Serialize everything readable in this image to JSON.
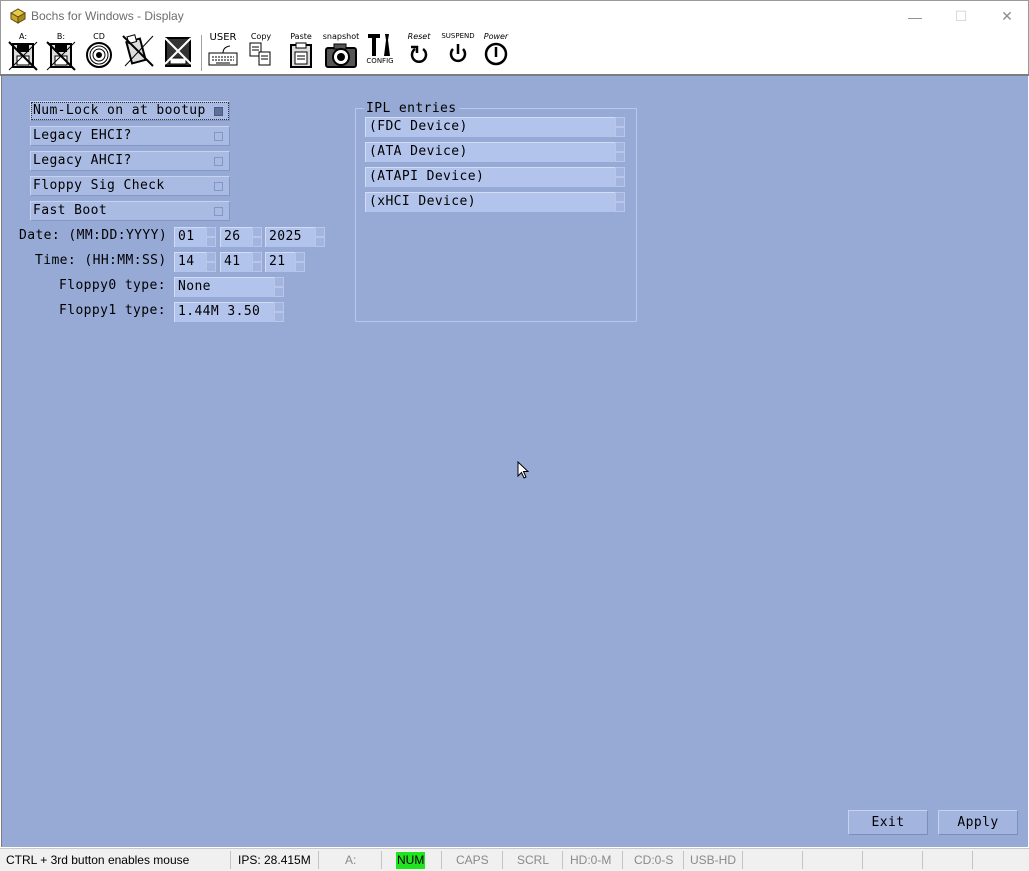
{
  "window": {
    "title": "Bochs for Windows - Display",
    "minimize_glyph": "—",
    "maximize_glyph": "☐",
    "close_glyph": "✕"
  },
  "toolbar": {
    "floppy_a_label": "A:",
    "floppy_b_label": "B:",
    "cdrom_label": "CD",
    "user_label": "USER",
    "copy_label": "Copy",
    "paste_label": "Paste",
    "snapshot_label": "snapshot",
    "config_label": "CONFIG",
    "reset_label": "Reset",
    "suspend_label": "SUSPEND",
    "power_label": "Power"
  },
  "bios_setup": {
    "options": [
      {
        "label": "Num-Lock on at bootup",
        "checked": true
      },
      {
        "label": "Legacy EHCI?",
        "checked": false
      },
      {
        "label": "Legacy AHCI?",
        "checked": false
      },
      {
        "label": "Floppy Sig Check",
        "checked": false
      },
      {
        "label": "Fast Boot",
        "checked": false
      }
    ],
    "date": {
      "label": "Date: (MM:DD:YYYY)",
      "month": "01",
      "day": "26",
      "year": "2025"
    },
    "time": {
      "label": "Time: (HH:MM:SS)",
      "hour": "14",
      "minute": "41",
      "second": "21"
    },
    "floppy0": {
      "label": "Floppy0 type:",
      "value": "None"
    },
    "floppy1": {
      "label": "Floppy1 type:",
      "value": "1.44M 3.50"
    },
    "ipl": {
      "title": "IPL entries",
      "entries": [
        "(FDC Device)",
        "(ATA Device)",
        "(ATAPI Device)",
        "(xHCI Device)"
      ]
    },
    "buttons": {
      "exit": "Exit",
      "apply": "Apply"
    }
  },
  "statusbar": {
    "hint": "CTRL + 3rd button enables mouse",
    "ips": "IPS: 28.415M",
    "floppy": "A:",
    "num": "NUM",
    "caps": "CAPS",
    "scrl": "SCRL",
    "hd": "HD:0-M",
    "cd": "CD:0-S",
    "usb": "USB-HD",
    "num_color": "#21e421"
  },
  "colors": {
    "display_background": "#97aad6",
    "field_background": "#b3c4ec"
  }
}
